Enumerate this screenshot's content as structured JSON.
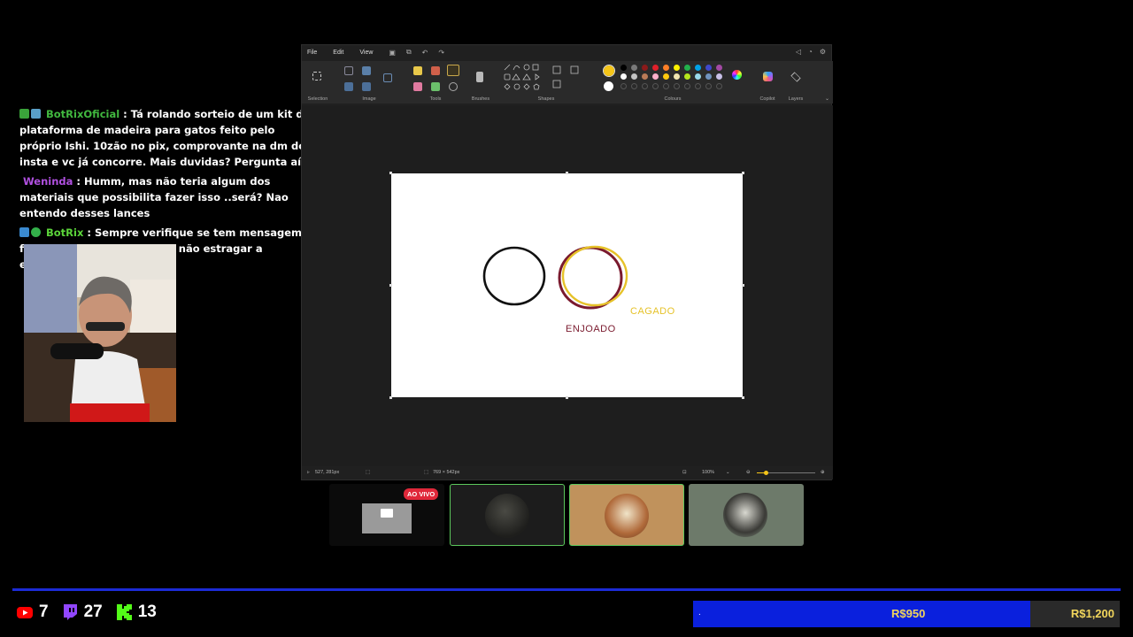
{
  "chat": {
    "messages": [
      {
        "user": "BotRixOficial",
        "text": ": Tá rolando sorteio de um kit de plataforma de madeira para gatos feito pelo próprio Ishi. 10zão no pix, comprovante na dm do insta e vc já concorre. Mais duvidas? Pergunta aí"
      },
      {
        "user": "Weninda",
        "text": ": Humm, mas não teria algum dos materiais que possibilita fazer isso ..será? Nao entendo desses lances"
      },
      {
        "user": "BotRix",
        "text": ": Sempre verifique se tem mensagem fixada no topo do chat, pra não estragar a experiencia do jogo"
      }
    ]
  },
  "paint": {
    "menu": {
      "file": "File",
      "edit": "Edit",
      "view": "View"
    },
    "ribbon": {
      "selection": "Selection",
      "image": "Image",
      "tools": "Tools",
      "brushes": "Brushes",
      "shapes": "Shapes",
      "colours": "Colours",
      "copilot": "Copilot",
      "layers": "Layers"
    },
    "palette_row1": [
      "#000000",
      "#7a7a7a",
      "#8b1a1a",
      "#e0202a",
      "#ff7f27",
      "#fff200",
      "#22b14c",
      "#00a2e8",
      "#3f48cc",
      "#a349a4"
    ],
    "palette_row2": [
      "#ffffff",
      "#c3c3c3",
      "#b97a57",
      "#ffaec9",
      "#ffc90e",
      "#efe4b0",
      "#b5e61d",
      "#99d9ea",
      "#7092be",
      "#c8bfe7"
    ],
    "primary_color": "#f5c518",
    "canvas": {
      "label_enjoado": "ENJOADO",
      "label_cagado": "CAGADO"
    },
    "status": {
      "cursor": "527, 281px",
      "size": "769 × 542px",
      "zoom": "100%"
    }
  },
  "scenes": {
    "live_badge": "AO VIVO"
  },
  "stats": {
    "youtube": "7",
    "twitch": "27",
    "kick": "13"
  },
  "goal": {
    "progress": 0.79,
    "dot": ".",
    "current": "R$950",
    "target": "R$1,200"
  },
  "colors": {
    "accent_blue": "#0a20dd",
    "goal_text": "#f2d65c",
    "enjoado": "#7a1a2e",
    "cagado": "#e6c229"
  }
}
